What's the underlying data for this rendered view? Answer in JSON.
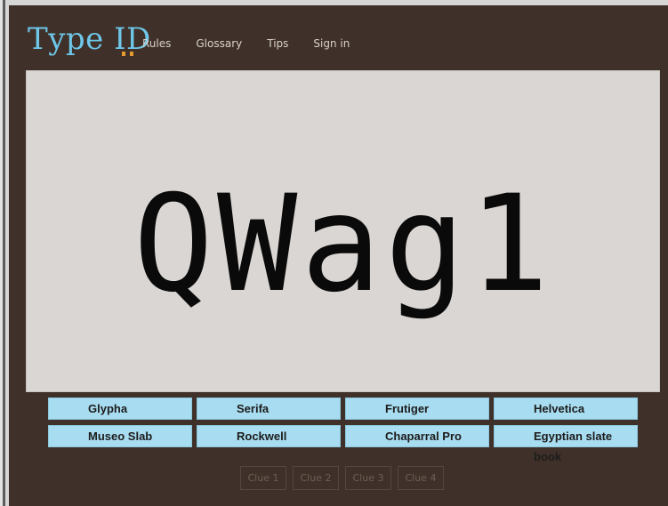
{
  "header": {
    "logo_text": "Type I",
    "logo_text_mark": "D",
    "nav": [
      "Rules",
      "Glossary",
      "Tips",
      "Sign in"
    ]
  },
  "specimen": {
    "text": "QWag1"
  },
  "choices": [
    "Glypha",
    "Serifa",
    "Frutiger",
    "Helvetica",
    "Museo Slab",
    "Rockwell",
    "Chaparral Pro",
    "Egyptian slate book"
  ],
  "clues": [
    "Clue 1",
    "Clue 2",
    "Clue 3",
    "Clue 4"
  ],
  "colors": {
    "background": "#3f3129",
    "logo": "#6ec6e8",
    "logo_dots": "#e49a2c",
    "choice_button": "#a8dcf0",
    "specimen_panel": "#dad6d3"
  }
}
